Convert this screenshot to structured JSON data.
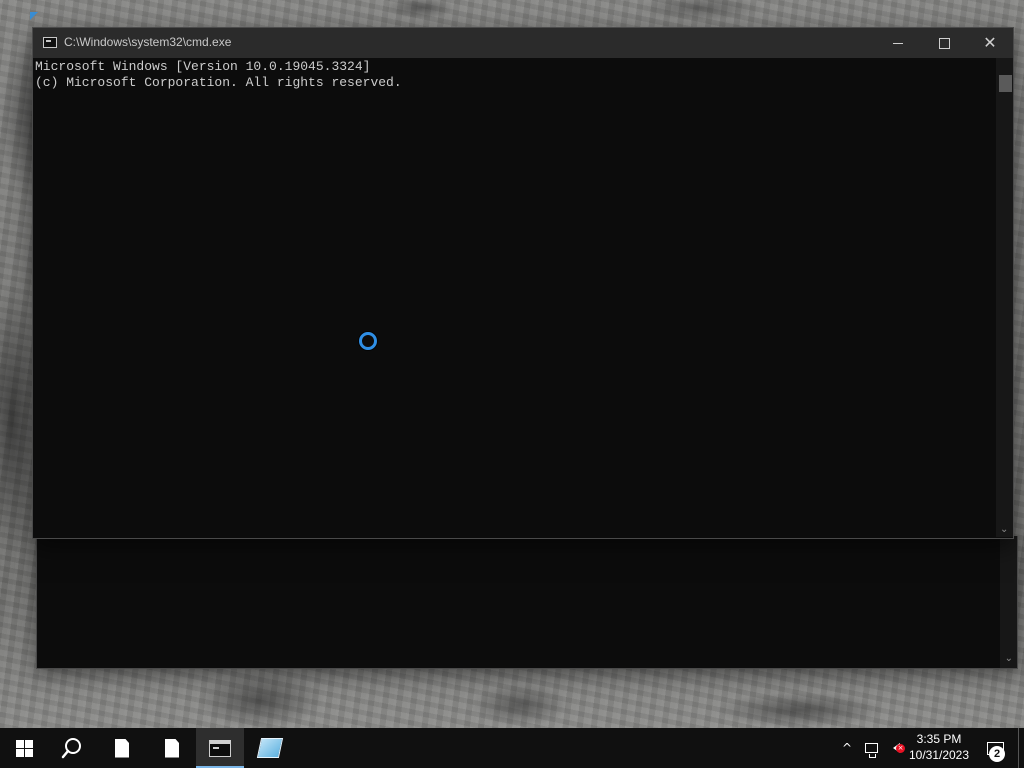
{
  "colors": {
    "console_background": "#0c0c0c",
    "console_text": "#cccccc",
    "titlebar": "#2b2b2b",
    "taskbar": "#101010",
    "active_task_indicator": "#7bb6e8",
    "busy_cursor": "#2f8fe6"
  },
  "window": {
    "title": "C:\\Windows\\system32\\cmd.exe",
    "icon": "console-icon",
    "controls": {
      "minimize_icon": "minimize-icon",
      "maximize_icon": "maximize-icon",
      "close_glyph": "✕"
    }
  },
  "console": {
    "lines": [
      "Microsoft Windows [Version 10.0.19045.3324]",
      "(c) Microsoft Corporation. All rights reserved."
    ]
  },
  "scrollbar": {
    "down_arrow": "⌄"
  },
  "taskbar": {
    "items": [
      {
        "name": "start",
        "icon": "windows-logo-icon"
      },
      {
        "name": "search",
        "icon": "search-icon"
      },
      {
        "name": "file-1",
        "icon": "document-icon"
      },
      {
        "name": "file-2",
        "icon": "document-icon"
      },
      {
        "name": "command-prompt",
        "icon": "console-icon",
        "active": true
      },
      {
        "name": "notes",
        "icon": "notepad-icon"
      }
    ],
    "tray": {
      "chevron": "^",
      "network_icon": "network-icon",
      "volume_icon": "volume-muted-icon",
      "volume_badge": "×",
      "time": "3:35 PM",
      "date": "10/31/2023",
      "notification_icon": "action-center-icon",
      "notification_count": "2"
    }
  }
}
